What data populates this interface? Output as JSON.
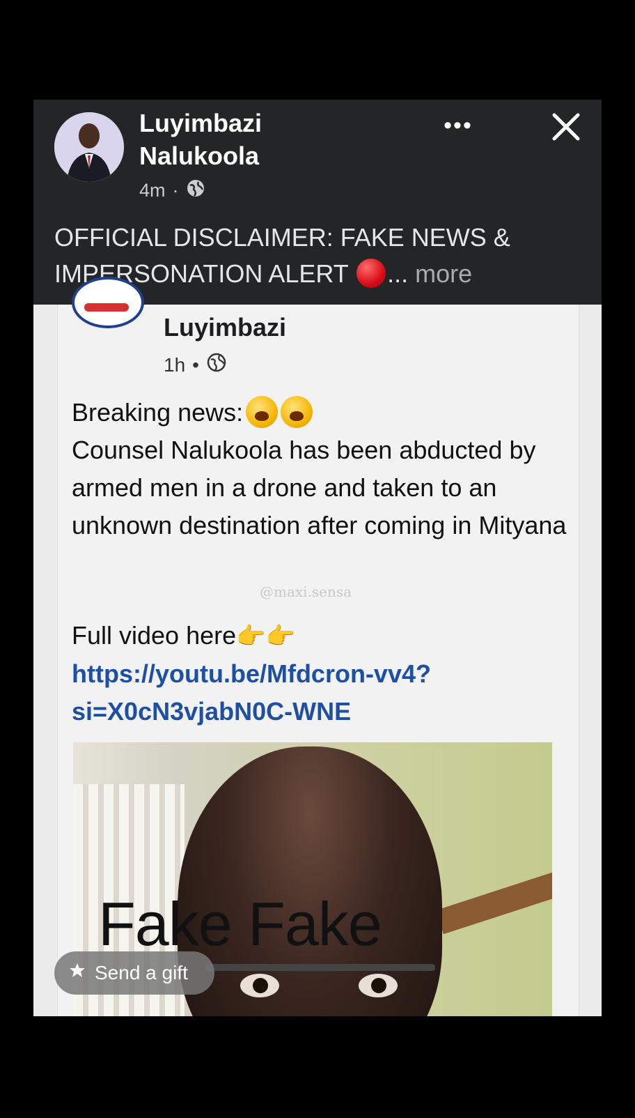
{
  "post": {
    "author": "Luyimbazi Nalukoola",
    "time": "4m",
    "separator": "·",
    "caption": "OFFICIAL DISCLAIMER: FAKE NEWS & IMPERSONATION ALERT",
    "ellipsis": "...",
    "more_label": "more"
  },
  "shared_post": {
    "author": "Luyimbazi",
    "time": "1h",
    "separator": "•",
    "text_line1": "Breaking news:",
    "text_body": "Counsel Nalukoola has been abducted by armed men in a drone and taken to an unknown destination after coming in Mityana",
    "watermark": "@maxi.sensa",
    "video_prefix": "Full video here",
    "link": "https://youtu.be/Mfdcron-vv4?si=X0cN3vjabN0C-WNE",
    "image_overlay_text": "Fake Fake"
  },
  "gift_button": {
    "label": "Send a gift"
  }
}
